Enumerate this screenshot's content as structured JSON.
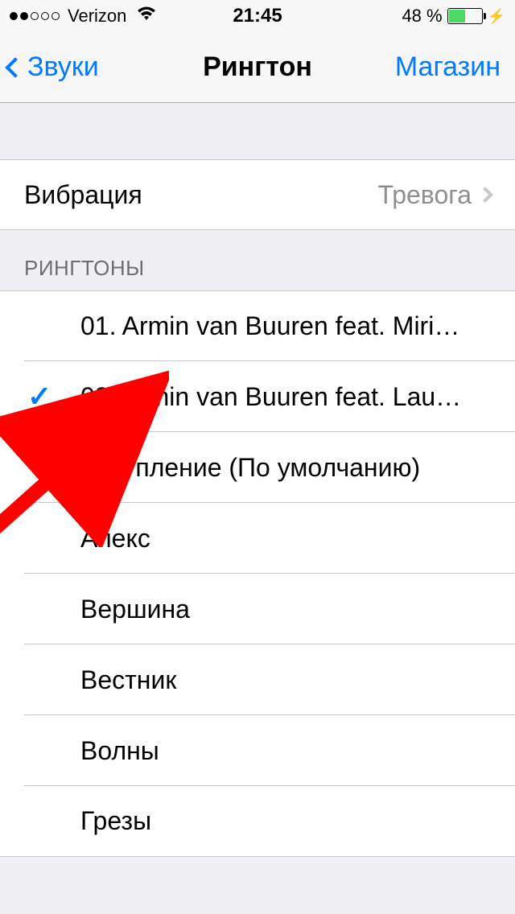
{
  "status_bar": {
    "carrier": "Verizon",
    "time": "21:45",
    "battery_pct": "48 %"
  },
  "nav": {
    "back_label": "Звуки",
    "title": "Рингтон",
    "store_label": "Магазин"
  },
  "vibration": {
    "label": "Вибрация",
    "value": "Тревога"
  },
  "section_header": "РИНГТОНЫ",
  "ringtones": [
    {
      "label": "01. Armin van Buuren feat. Miri…",
      "selected": false
    },
    {
      "label": "08. Armin van Buuren feat. Lau…",
      "selected": true
    },
    {
      "label": "Вступление (По умолчанию)",
      "selected": false
    },
    {
      "label": "Апекс",
      "selected": false
    },
    {
      "label": "Вершина",
      "selected": false
    },
    {
      "label": "Вестник",
      "selected": false
    },
    {
      "label": "Волны",
      "selected": false
    },
    {
      "label": "Грезы",
      "selected": false
    }
  ]
}
